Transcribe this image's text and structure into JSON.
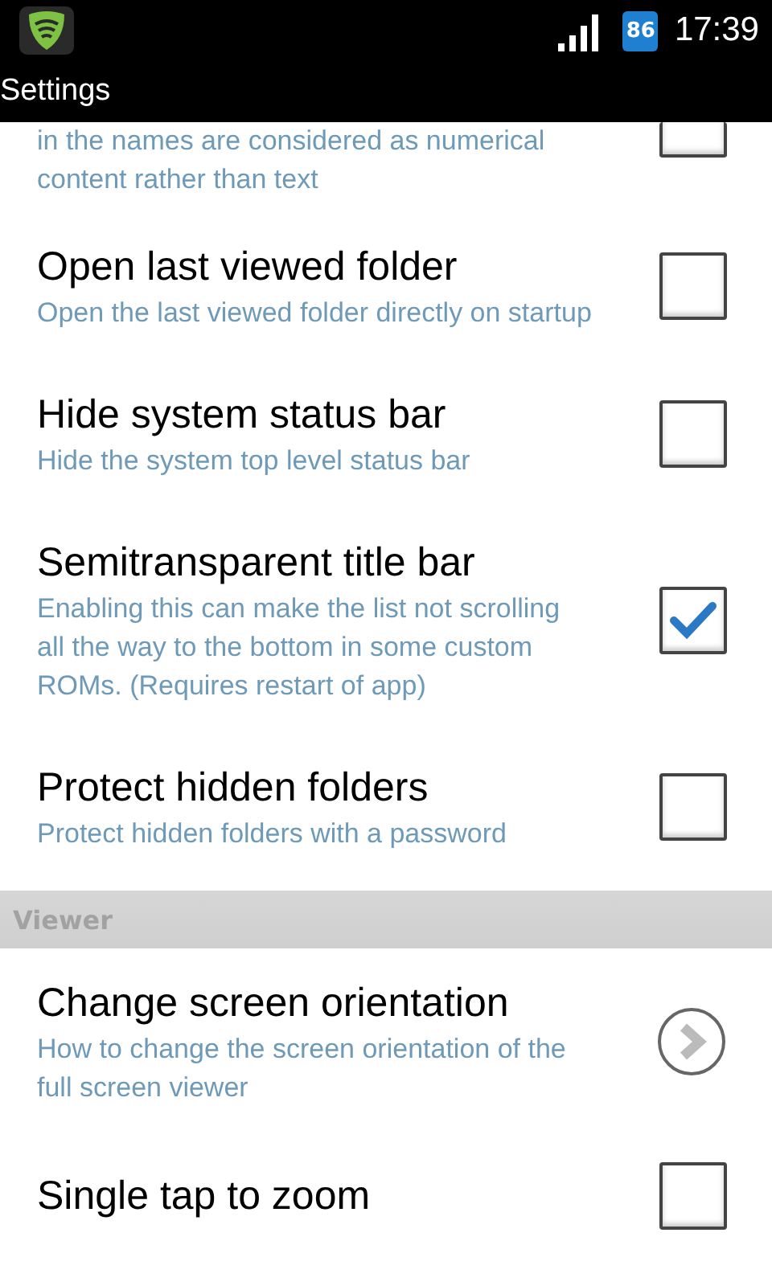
{
  "status_bar": {
    "battery": "86",
    "time": "17:39"
  },
  "title_bar": {
    "title": "Settings"
  },
  "items": [
    {
      "kind": "checkbox",
      "summary": "in the names are considered as numerical content rather than text",
      "checked": false,
      "cut_top": true
    },
    {
      "kind": "checkbox",
      "title": "Open last viewed folder",
      "summary": "Open the last viewed folder directly on startup",
      "checked": false
    },
    {
      "kind": "checkbox",
      "title": "Hide system status bar",
      "summary": "Hide the system top level status bar",
      "checked": false
    },
    {
      "kind": "checkbox",
      "title": "Semitransparent title bar",
      "summary": "Enabling this can make the list not scrolling all the way to the bottom in some custom ROMs. (Requires restart of app)",
      "checked": true
    },
    {
      "kind": "checkbox",
      "title": "Protect hidden folders",
      "summary": "Protect hidden folders with a password",
      "checked": false
    },
    {
      "kind": "header",
      "title": "Viewer"
    },
    {
      "kind": "link",
      "title": "Change screen orientation",
      "summary": "How to change the screen orientation of the full screen viewer"
    },
    {
      "kind": "checkbox",
      "title": "Single tap to zoom",
      "checked": false
    }
  ]
}
